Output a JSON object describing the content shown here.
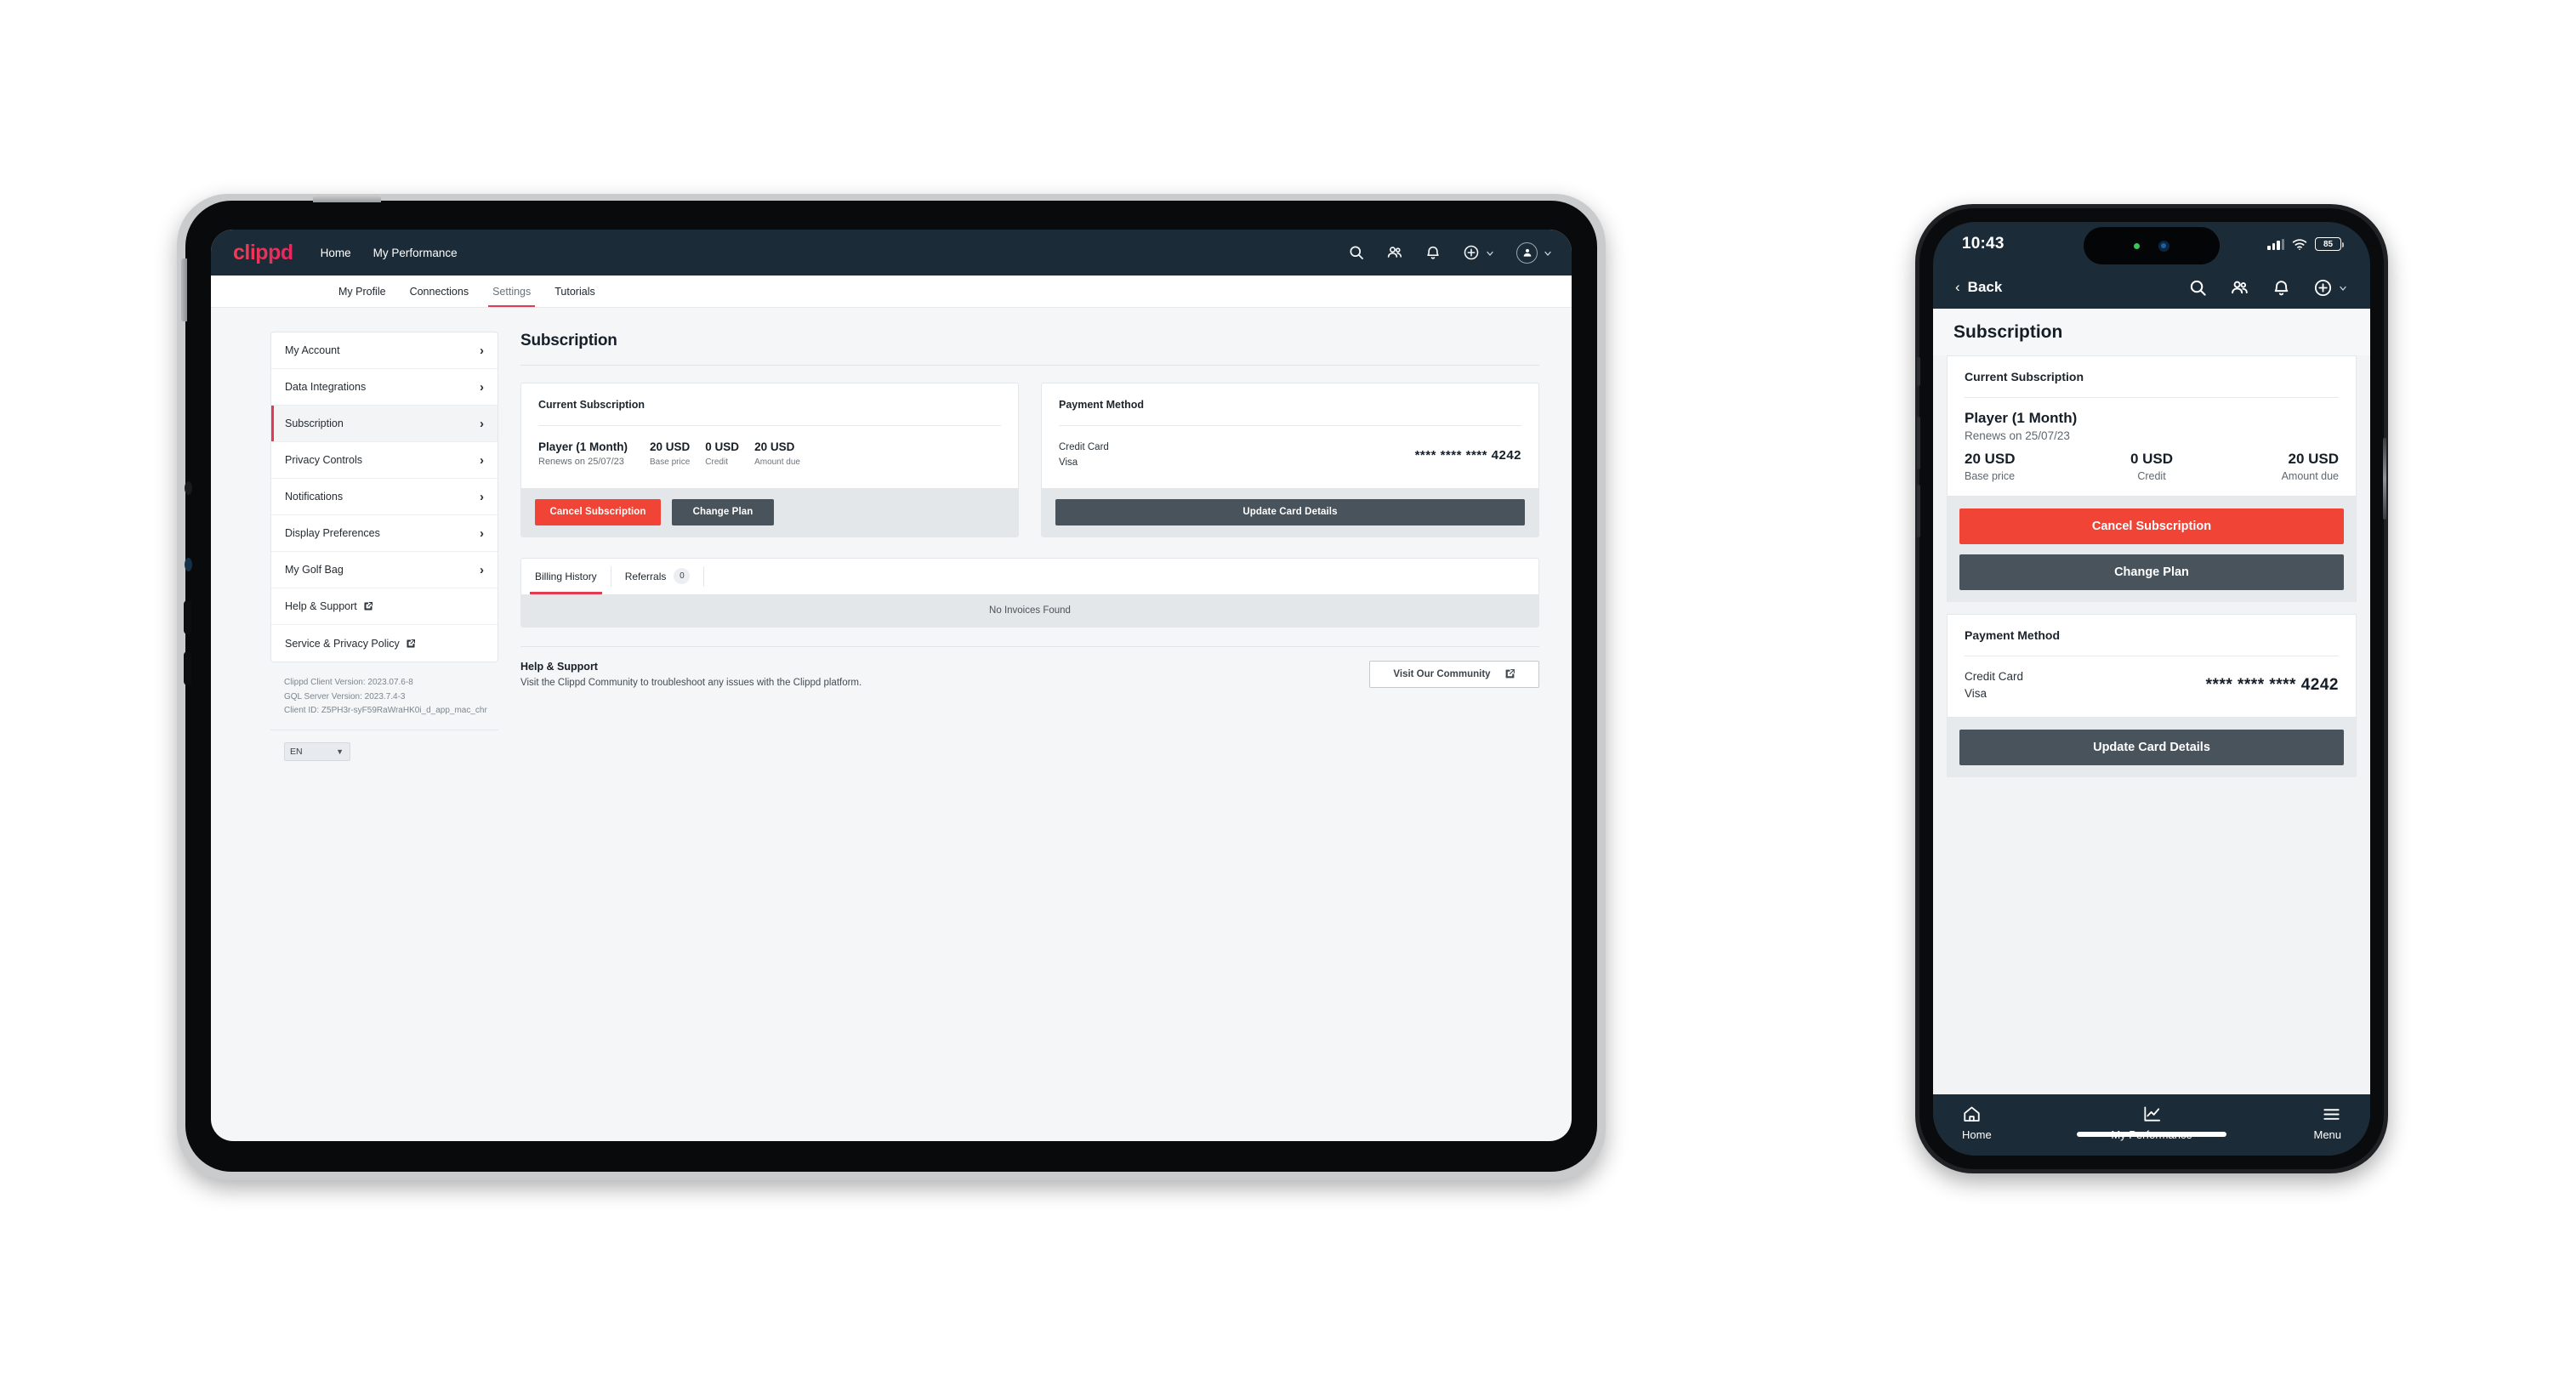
{
  "brand": {
    "logo_text": "clippd",
    "accent": "#e23a52",
    "danger": "#ef4436",
    "dark": "#49535c",
    "navy": "#1c2b38"
  },
  "tablet": {
    "navbar": {
      "links": [
        {
          "label": "Home"
        },
        {
          "label": "My Performance"
        }
      ],
      "icons": [
        "search-icon",
        "people-icon",
        "bell-icon",
        "plus-circle-icon",
        "avatar-icon"
      ]
    },
    "subnav": {
      "tabs": [
        {
          "label": "My Profile",
          "active": false
        },
        {
          "label": "Connections",
          "active": false
        },
        {
          "label": "Settings",
          "active": true
        },
        {
          "label": "Tutorials",
          "active": false
        }
      ]
    },
    "sidebar": {
      "items": [
        {
          "label": "My Account",
          "active": false,
          "external": false
        },
        {
          "label": "Data Integrations",
          "active": false,
          "external": false
        },
        {
          "label": "Subscription",
          "active": true,
          "external": false
        },
        {
          "label": "Privacy Controls",
          "active": false,
          "external": false
        },
        {
          "label": "Notifications",
          "active": false,
          "external": false
        },
        {
          "label": "Display Preferences",
          "active": false,
          "external": false
        },
        {
          "label": "My Golf Bag",
          "active": false,
          "external": false
        },
        {
          "label": "Help & Support",
          "active": false,
          "external": true
        },
        {
          "label": "Service & Privacy Policy",
          "active": false,
          "external": true
        }
      ],
      "version": {
        "client": "Clippd Client Version: 2023.07.6-8",
        "server": "GQL Server Version: 2023.7.4-3",
        "client_id": "Client ID: Z5PH3r-syF59RaWraHK0i_d_app_mac_chr"
      },
      "language": {
        "value": "EN"
      }
    },
    "main": {
      "page_title": "Subscription",
      "current_subscription": {
        "heading": "Current Subscription",
        "plan_name": "Player (1 Month)",
        "renews": "Renews on 25/07/23",
        "amounts": [
          {
            "value": "20 USD",
            "label": "Base price"
          },
          {
            "value": "0 USD",
            "label": "Credit"
          },
          {
            "value": "20 USD",
            "label": "Amount due"
          }
        ],
        "cancel_label": "Cancel Subscription",
        "change_label": "Change Plan"
      },
      "payment_method": {
        "heading": "Payment Method",
        "type": "Credit Card",
        "brand": "Visa",
        "number": "**** **** **** 4242",
        "update_label": "Update Card Details"
      },
      "billing": {
        "tabs": [
          {
            "label": "Billing History",
            "active": true,
            "badge": null
          },
          {
            "label": "Referrals",
            "active": false,
            "badge": "0"
          }
        ],
        "empty_text": "No Invoices Found"
      },
      "help": {
        "title": "Help & Support",
        "subtitle": "Visit the Clippd Community to troubleshoot any issues with the Clippd platform.",
        "button_label": "Visit Our Community"
      }
    }
  },
  "phone": {
    "status": {
      "time": "10:43",
      "battery": "85"
    },
    "header": {
      "back_label": "Back",
      "icons": [
        "search-icon",
        "people-icon",
        "bell-icon",
        "plus-circle-icon"
      ]
    },
    "page_title": "Subscription",
    "current_subscription": {
      "heading": "Current Subscription",
      "plan_name": "Player (1 Month)",
      "renews": "Renews on 25/07/23",
      "amounts": [
        {
          "value": "20 USD",
          "label": "Base price"
        },
        {
          "value": "0 USD",
          "label": "Credit"
        },
        {
          "value": "20 USD",
          "label": "Amount due"
        }
      ],
      "cancel_label": "Cancel Subscription",
      "change_label": "Change Plan"
    },
    "payment_method": {
      "heading": "Payment Method",
      "type": "Credit Card",
      "brand": "Visa",
      "number": "**** **** **** 4242",
      "update_label": "Update Card Details"
    },
    "tabbar": [
      {
        "label": "Home",
        "icon": "home-icon"
      },
      {
        "label": "My Performance",
        "icon": "chart-line-icon"
      },
      {
        "label": "Menu",
        "icon": "hamburger-icon"
      }
    ]
  }
}
